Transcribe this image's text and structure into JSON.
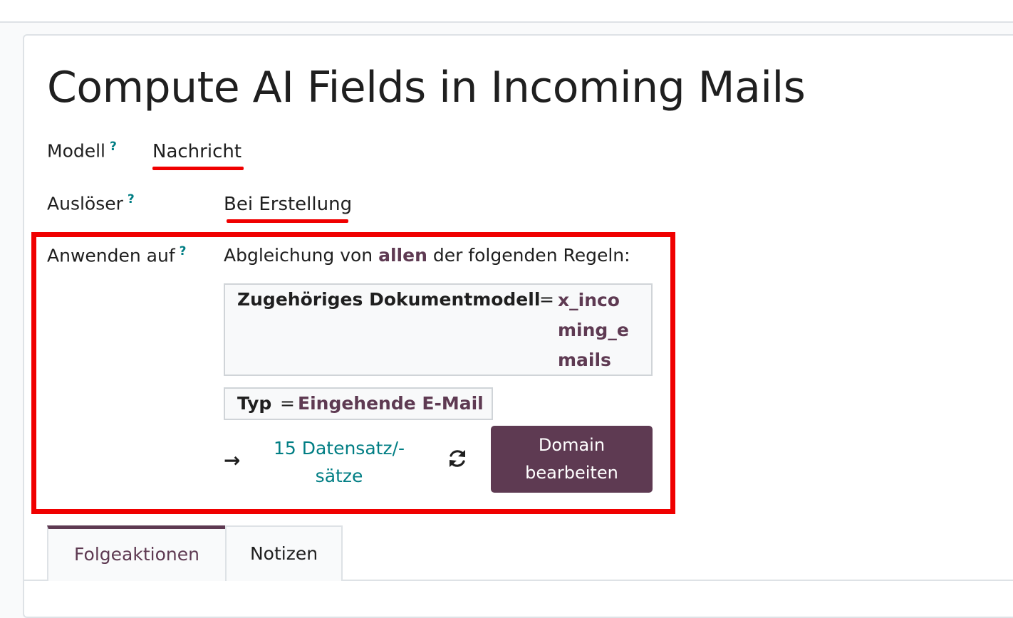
{
  "title": "Compute AI Fields in Incoming Mails",
  "fields": {
    "model": {
      "label": "Modell",
      "help": "?",
      "value": "Nachricht"
    },
    "trigger": {
      "label": "Auslöser",
      "help": "?",
      "value": "Bei Erstellung"
    },
    "apply_on": {
      "label": "Anwenden auf",
      "help": "?",
      "rule_prefix": "Abgleichung von",
      "rule_keyword": "allen",
      "rule_suffix": "der folgenden Regeln:"
    }
  },
  "conditions": [
    {
      "field": "Zugehöriges Dokumentmodell",
      "operator": "=",
      "value": "x_incoming_emails"
    },
    {
      "field": "Typ",
      "operator": "=",
      "value": "Eingehende E-Mail"
    }
  ],
  "records": {
    "arrow": "→",
    "count_label": "15 Datensatz/-sätze"
  },
  "edit_domain_label": "Domain bearbeiten",
  "tabs": [
    {
      "label": "Folgeaktionen",
      "active": true
    },
    {
      "label": "Notizen",
      "active": false
    }
  ],
  "colors": {
    "primary": "#5e3a52",
    "link": "#017e84",
    "annotation": "#f00000"
  },
  "icons": {
    "refresh": "refresh-icon",
    "arrow": "arrow-right-icon"
  }
}
